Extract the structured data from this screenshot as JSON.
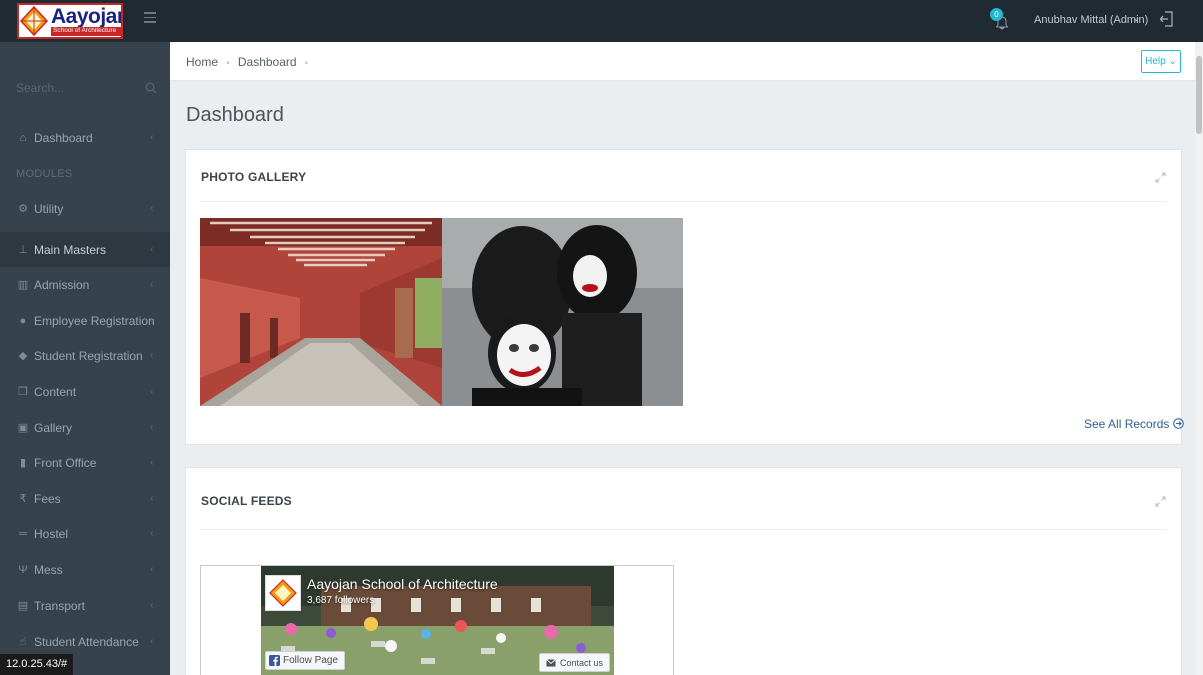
{
  "brand": {
    "title": "Aayojan",
    "subtitle": "School of Architecture"
  },
  "topbar": {
    "notification_count": "0",
    "user_name": "Anubhav Mittal (Admin)",
    "user_caret": "⌄"
  },
  "sidebar": {
    "search_placeholder": "Search...",
    "section_label": "MODULES",
    "items": [
      {
        "label": "Dashboard",
        "icon": "home-icon"
      },
      {
        "label": "Utility",
        "icon": "cogs-icon"
      },
      {
        "label": "Main Masters",
        "icon": "sitemap-icon"
      },
      {
        "label": "Admission",
        "icon": "bank-icon"
      },
      {
        "label": "Employee Registration",
        "icon": "user-icon"
      },
      {
        "label": "Student Registration",
        "icon": "graduation-cap-icon"
      },
      {
        "label": "Content",
        "icon": "copy-icon"
      },
      {
        "label": "Gallery",
        "icon": "image-icon"
      },
      {
        "label": "Front Office",
        "icon": "columns-icon"
      },
      {
        "label": "Fees",
        "icon": "rupee-icon"
      },
      {
        "label": "Hostel",
        "icon": "bed-icon"
      },
      {
        "label": "Mess",
        "icon": "cutlery-icon"
      },
      {
        "label": "Transport",
        "icon": "bus-icon"
      },
      {
        "label": "Student Attendance",
        "icon": "hand-pointer-icon"
      }
    ],
    "chevron": "‹"
  },
  "breadcrumb": {
    "home": "Home",
    "current": "Dashboard",
    "separator": "•"
  },
  "help_button": "Help ⌄",
  "page_title": "Dashboard",
  "photo_gallery": {
    "title": "PHOTO GALLERY",
    "see_all": "See All Records"
  },
  "social_feeds": {
    "title": "SOCIAL FEEDS",
    "fb_page_name": "Aayojan School of Architecture",
    "fb_followers": "3,687 followers",
    "fb_follow_label": "Follow Page",
    "fb_contact_label": "Contact us"
  },
  "status_url": "12.0.25.43/#",
  "colors": {
    "topbar": "#1f2a33",
    "sidebar": "#36434d",
    "accent": "#26b8cf",
    "link": "#2e5f95"
  }
}
